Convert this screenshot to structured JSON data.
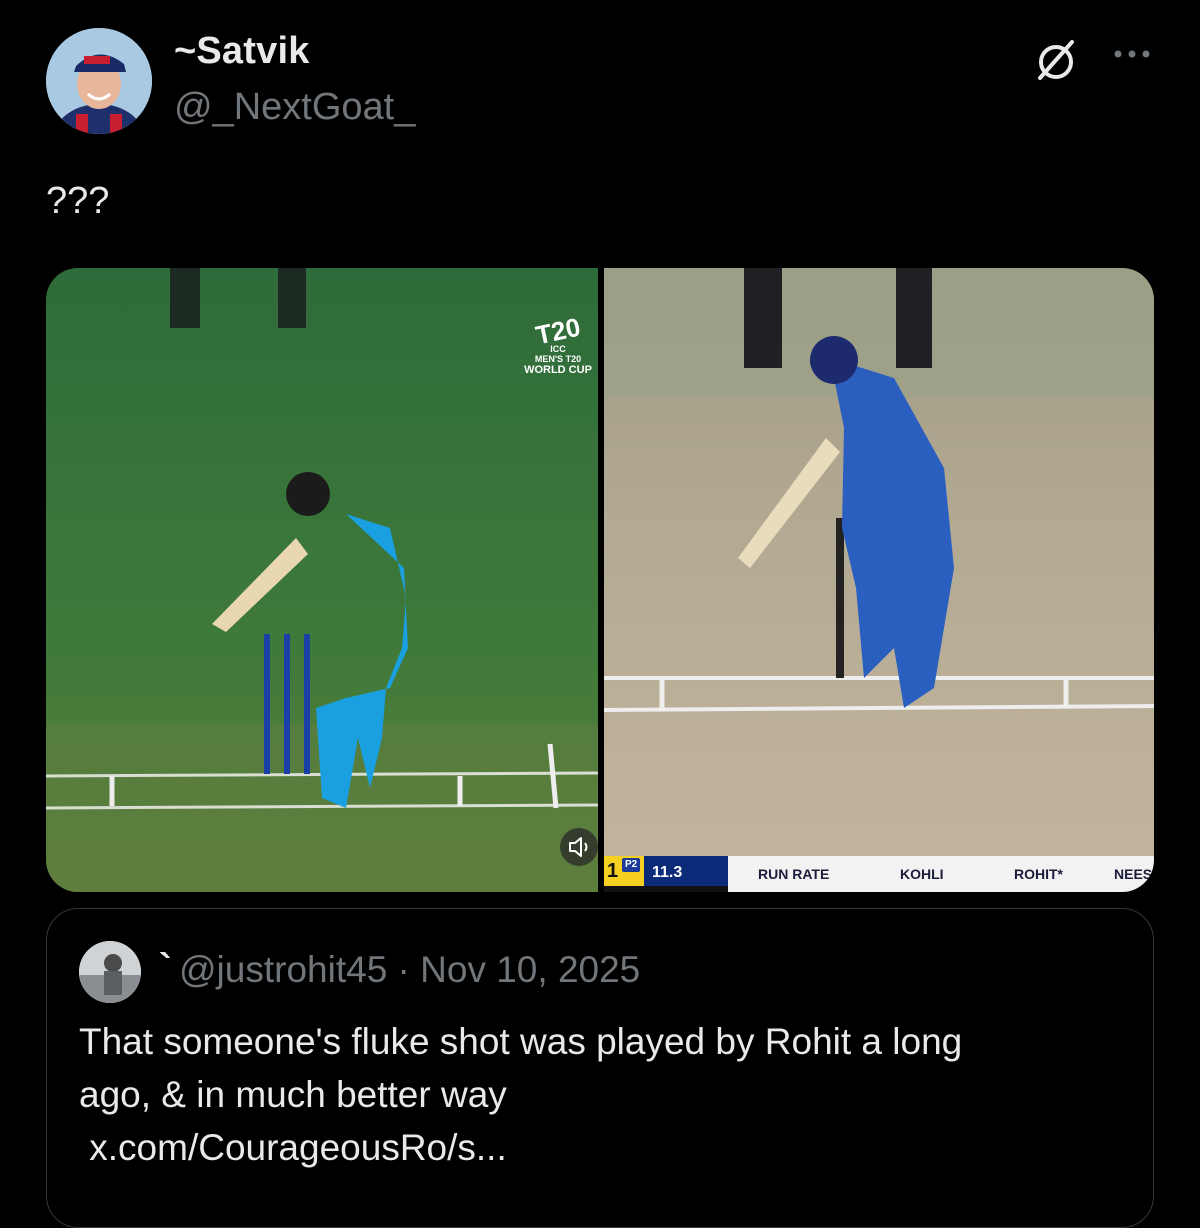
{
  "post": {
    "author": {
      "display_name": "~Satvik",
      "handle": "@_NextGoat_"
    },
    "text": "???",
    "media": {
      "left_clip": {
        "logo": {
          "line1": "T20",
          "line2": "ICC",
          "line3": "MEN'S T20",
          "line4": "WORLD CUP"
        }
      },
      "right_clip": {
        "scorebar": {
          "innings": "1",
          "powerplay": "P2",
          "overs": "11.3",
          "columns": [
            "RUN RATE",
            "KOHLI",
            "ROHIT*",
            "NEES"
          ]
        }
      }
    },
    "quoted_post": {
      "display_name": "`",
      "handle_date": "@justrohit45 · Nov 10, 2025",
      "text_lines": [
        "That someone's fluke shot was played by Rohit a long",
        "ago, & in much better way",
        " x.com/CourageousRo/s..."
      ]
    }
  },
  "colors": {
    "background": "#000000",
    "text_primary": "#e7e9ea",
    "text_secondary": "#71767b",
    "border": "#333639"
  },
  "icons": [
    "grok-icon",
    "more-icon",
    "volume-icon"
  ]
}
